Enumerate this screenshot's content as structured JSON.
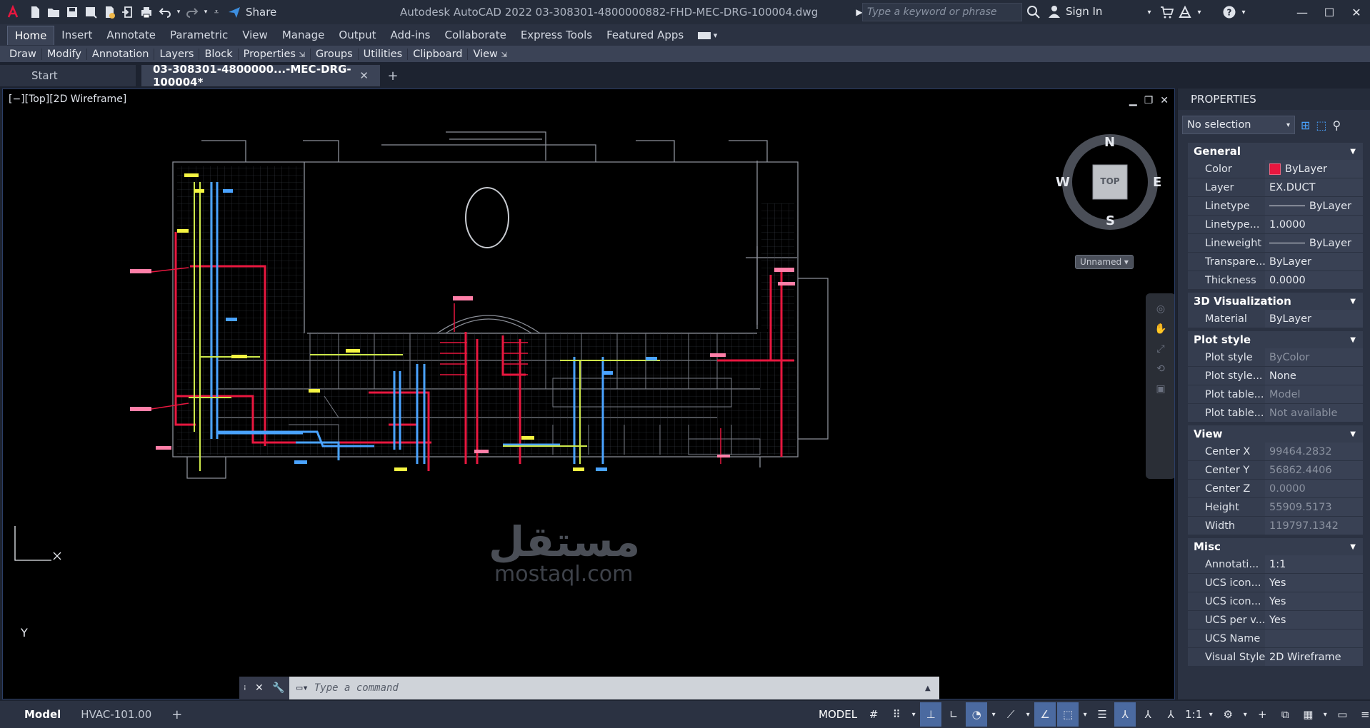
{
  "titlebar": {
    "app_title": "Autodesk AutoCAD 2022   03-308301-4800000882-FHD-MEC-DRG-100004.dwg",
    "share_label": "Share",
    "search_placeholder": "Type a keyword or phrase",
    "signin_label": "Sign In"
  },
  "ribbon": {
    "tabs": [
      "Home",
      "Insert",
      "Annotate",
      "Parametric",
      "View",
      "Manage",
      "Output",
      "Add-ins",
      "Collaborate",
      "Express Tools",
      "Featured Apps"
    ],
    "active_tab": "Home",
    "panels": [
      "Draw",
      "Modify",
      "Annotation",
      "Layers",
      "Block",
      "Properties",
      "Groups",
      "Utilities",
      "Clipboard",
      "View"
    ]
  },
  "doc_tabs": {
    "start": "Start",
    "current": "03-308301-4800000...-MEC-DRG-100004*"
  },
  "viewport": {
    "label": "[−][Top][2D Wireframe]",
    "viewcube": {
      "face": "TOP",
      "n": "N",
      "s": "S",
      "e": "E",
      "w": "W"
    },
    "named_view": "Unnamed",
    "ucs_y": "Y"
  },
  "command": {
    "placeholder": "Type a command"
  },
  "properties": {
    "title": "PROPERTIES",
    "selection": "No selection",
    "sections": [
      {
        "title": "General",
        "rows": [
          {
            "k": "Color",
            "v": "ByLayer"
          },
          {
            "k": "Layer",
            "v": "EX.DUCT"
          },
          {
            "k": "Linetype",
            "v": "ByLayer"
          },
          {
            "k": "Linetype...",
            "v": "1.0000"
          },
          {
            "k": "Lineweight",
            "v": "ByLayer"
          },
          {
            "k": "Transpare...",
            "v": "ByLayer"
          },
          {
            "k": "Thickness",
            "v": "0.0000"
          }
        ]
      },
      {
        "title": "3D Visualization",
        "rows": [
          {
            "k": "Material",
            "v": "ByLayer"
          }
        ]
      },
      {
        "title": "Plot style",
        "rows": [
          {
            "k": "Plot style",
            "v": "ByColor"
          },
          {
            "k": "Plot style...",
            "v": "None"
          },
          {
            "k": "Plot table...",
            "v": "Model"
          },
          {
            "k": "Plot table...",
            "v": "Not available"
          }
        ]
      },
      {
        "title": "View",
        "rows": [
          {
            "k": "Center X",
            "v": "99464.2832"
          },
          {
            "k": "Center Y",
            "v": "56862.4406"
          },
          {
            "k": "Center Z",
            "v": "0.0000"
          },
          {
            "k": "Height",
            "v": "55909.5173"
          },
          {
            "k": "Width",
            "v": "119797.1342"
          }
        ]
      },
      {
        "title": "Misc",
        "rows": [
          {
            "k": "Annotati...",
            "v": "1:1"
          },
          {
            "k": "UCS icon...",
            "v": "Yes"
          },
          {
            "k": "UCS icon...",
            "v": "Yes"
          },
          {
            "k": "UCS per v...",
            "v": "Yes"
          },
          {
            "k": "UCS Name",
            "v": ""
          },
          {
            "k": "Visual Style",
            "v": "2D Wireframe"
          }
        ]
      }
    ]
  },
  "statusbar": {
    "layout_tabs": [
      "Model",
      "HVAC-101.00"
    ],
    "model_label": "MODEL",
    "scale": "1:1"
  },
  "watermark": {
    "arabic": "مستقل",
    "latin": "mostaql.com"
  },
  "colors": {
    "duct_red": "#e8173f",
    "duct_blue": "#4aa3ff",
    "duct_yellow": "#f5f542",
    "pink_tag": "#ff7fa8",
    "accent": "#4b6aa0"
  }
}
